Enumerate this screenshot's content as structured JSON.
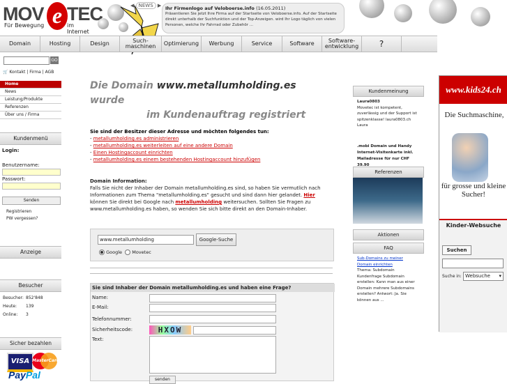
{
  "logo": {
    "text_left": "MOV",
    "text_e": "e",
    "text_right": "TEC",
    "tagline_left": "Für Bewegung",
    "tagline_right": "im Internet"
  },
  "news": {
    "badge": "NEWS",
    "title": "Ihr Firmenlogo auf Veloboerse.info",
    "date": "(16.05.2011)",
    "text": "Präsentieren Sie jetzt Ihre Firma auf der Startseite von Veloboerse.info. Auf der Startseite direkt unterhalb der Suchfunktion und der Top-Anzeigen. wird Ihr Logo täglich von vielen Personen, welche Ihr Fahrrad oder Zubehör ..."
  },
  "nav": [
    "Domain",
    "Hosting",
    "Design",
    "Such-\nmaschinen",
    "Optimierung",
    "Werbung",
    "Service",
    "Software",
    "Software-\nentwicklung",
    "?"
  ],
  "left": {
    "go": "GO",
    "cart_links": [
      "Kontakt",
      "Firma",
      "AGB"
    ],
    "menu": [
      "Home",
      "News",
      "Leistung/Produkte",
      "Referenzen",
      "Über uns / Firma"
    ],
    "kundenmenu_title": "Kundenmenü",
    "login": "Login:",
    "username": "Benutzername:",
    "password": "Passwort:",
    "send": "Senden",
    "register": "Registrieren",
    "forgot": "PW vergessen?",
    "anzeige": "Anzeige",
    "besucher_title": "Besucher",
    "besucher_rows": [
      [
        "Besucher:",
        "852'848"
      ],
      [
        "Heute:",
        "139"
      ],
      [
        "Online:",
        "3"
      ]
    ],
    "pay_title": "Sicher bezahlen",
    "visa": "VISA",
    "mastercard": "MasterCard",
    "paypal_a": "Pay",
    "paypal_b": "Pal"
  },
  "main": {
    "h1_a": "Die Domain ",
    "h1_domain": "www.metallumholding.es",
    "h1_b": " wurde",
    "h2": "im Kundenauftrag registriert",
    "owner_title": "Sie sind der Besitzer dieser Adresse und möchten folgendes tun:",
    "owner_links": [
      "metallumholding.es administrieren",
      "metallumholding.es weiterleiten auf eine andere Domain",
      "Einen Hostingaccount einrichten",
      "metallumholding.es einem bestehenden Hostingaccount hinzufügen"
    ],
    "info_title": "Domain Information:",
    "info_1": "Falls Sie nicht der Inhaber der Domain metallumholding.es sind, so haben Sie vermutlich nach Informationen zum Thema \"metallumholding.es\" gesucht und sind dann hier gelandet.",
    "info_hier": "Hier",
    "info_2": " können Sie direkt bei Google nach ",
    "info_kw": "metallumholding",
    "info_3": " weitersuchen. Sollten Sie Fragen zu www.metallumholding.es haben, so wenden Sie sich bitte direkt an den Domain-Inhaber.",
    "search_value": "www.metallumholding",
    "search_button": "Google-Suche",
    "radio_google": "Google",
    "radio_movetec": "Movetec",
    "form_title": "Sie sind Inhaber der Domain metallumholding.es und haben eine Frage?",
    "form_name": "Name:",
    "form_email": "E-Mail:",
    "form_phone": "Telefonnummer:",
    "form_code": "Sicherheitscode:",
    "form_text": "Text:",
    "captcha": "HXOW",
    "form_send": "senden"
  },
  "right": {
    "kundenmeinung_title": "Kundenmeinung",
    "kundenmeinung_name": "Laura0803",
    "kundenmeinung_text": "Movetec ist kompetent, zuverlässig und der Support ist spitzenklasse! laura0803.ch Laura",
    "promo": ".mobi Domain und Handy Internet-Visitenkarte inkl. Mailadresse für nur CHF 39.90",
    "referenzen_title": "Referenzen",
    "aktionen_title": "Aktionen",
    "faq_title": "FAQ",
    "faq_link": "Sub-Domains zu meiner Domain einrichten",
    "faq_text": "Thema: Subdomain Kundenfrage Subdomain erstellen: Kann man aus einer Domain mehrere Subdomains erstellen? Antwort: Ja. Sie können aus ..."
  },
  "ad": {
    "brand": "www.kids24.ch",
    "slogan1": "Die Suchmaschine,",
    "slogan2": "für grosse und kleine Sucher!",
    "search_title": "Kinder-Websuche",
    "search_button": "Suchen",
    "search_in": "Suche in:",
    "search_select": "Websuche"
  }
}
